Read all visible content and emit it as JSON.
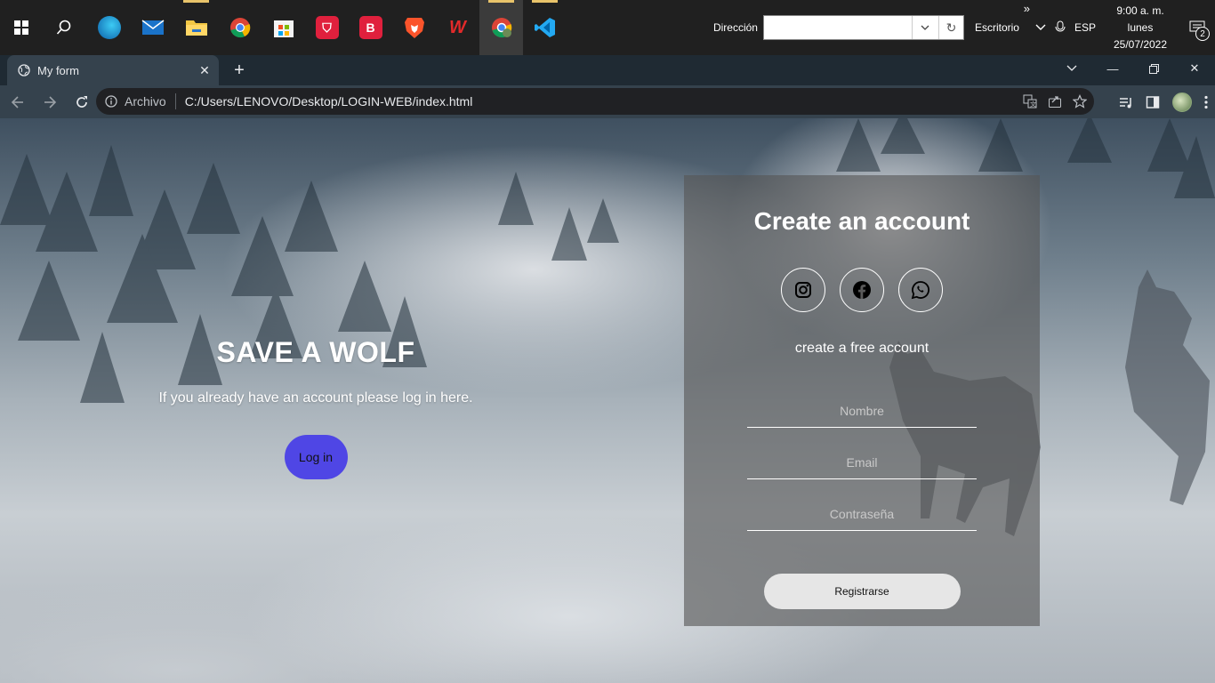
{
  "taskbar": {
    "apps": [
      {
        "name": "edge",
        "color": "#0f7bd1"
      },
      {
        "name": "mail",
        "color": "#1a73c9"
      },
      {
        "name": "file-explorer",
        "color": "#f2c744"
      },
      {
        "name": "chrome",
        "color": "#db4437"
      },
      {
        "name": "microsoft-store",
        "color": "#f3f3f3"
      },
      {
        "name": "brave-vpn",
        "color": "#e0203d"
      },
      {
        "name": "b-app",
        "color": "#e0203d"
      },
      {
        "name": "brave",
        "color": "#fb542b"
      },
      {
        "name": "wps-office",
        "color": "#e32a2a"
      },
      {
        "name": "chrome-profile",
        "color": "#db4437"
      },
      {
        "name": "vscode",
        "color": "#23a9f2"
      }
    ],
    "address_label": "Dirección",
    "address_value": "",
    "desktop_label": "Escritorio",
    "overflow_label": "»",
    "lang": "ESP",
    "clock": {
      "time": "9:00 a. m.",
      "day": "lunes",
      "date": "25/07/2022"
    },
    "notification_count": "2"
  },
  "browser": {
    "tab_title": "My form",
    "url_scheme": "Archivo",
    "url": "C:/Users/LENOVO/Desktop/LOGIN-WEB/index.html"
  },
  "hero": {
    "title": "SAVE A WOLF",
    "subtitle": "If you already have an account please log in here.",
    "login_label": "Log in"
  },
  "signup": {
    "title": "Create an account",
    "socials": [
      "instagram",
      "facebook",
      "whatsapp"
    ],
    "subtitle": "create a free account",
    "name_placeholder": "Nombre",
    "email_placeholder": "Email",
    "password_placeholder": "Contraseña",
    "submit_label": "Registrarse"
  },
  "colors": {
    "login_button": "#4f46e5",
    "card_overlay": "rgba(85,85,85,0.62)"
  }
}
